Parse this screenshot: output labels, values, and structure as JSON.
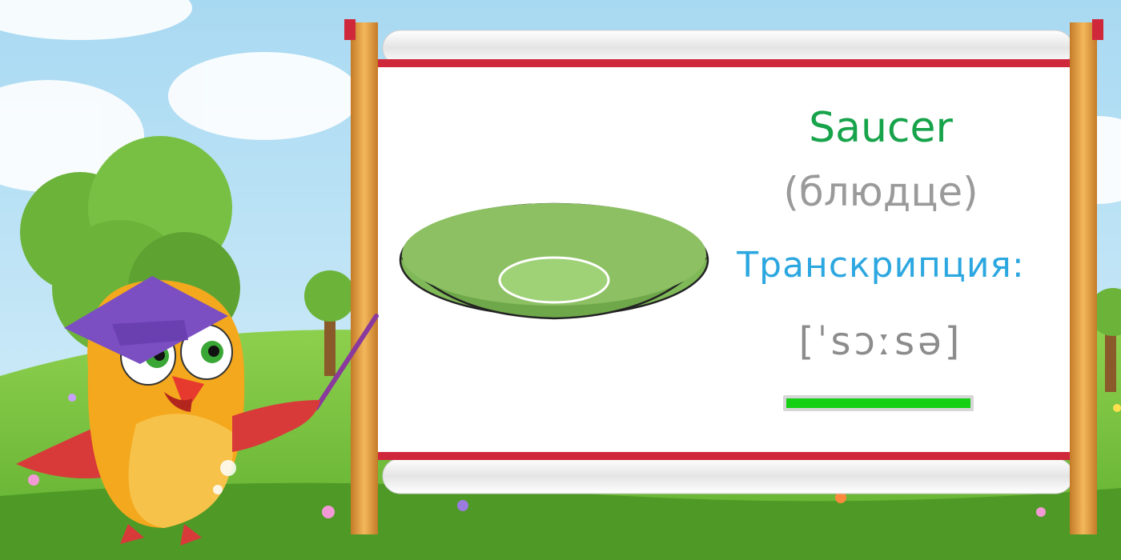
{
  "card": {
    "word": "Saucer",
    "translation": "(блюдце)",
    "transcription_label": "Транскрипция:",
    "transcription": "[ˈsɔːsə]"
  },
  "progress": {
    "fraction": 1.0,
    "color": "#15d015"
  },
  "colors": {
    "word": "#16a34a",
    "translation": "#9a9a9a",
    "transcription_label": "#2ca7e0",
    "sky": "#bfe3f5",
    "grass": "#6fbd3b",
    "saucer": "#86c060",
    "frame_wood": "#e9a548",
    "frame_rod": "#d0283b"
  },
  "icons": {
    "mascot": "owl-teacher-icon",
    "item": "saucer-icon",
    "pointer": "pointer-stick-icon"
  }
}
